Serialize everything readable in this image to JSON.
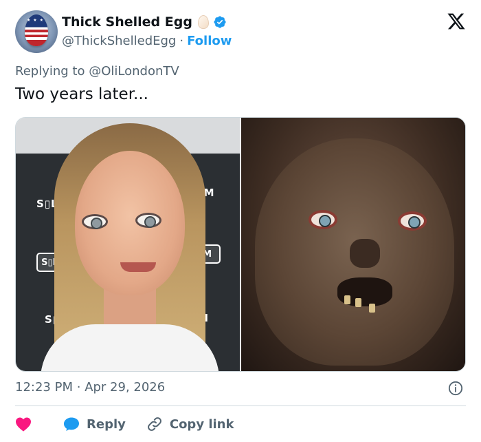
{
  "author": {
    "display_name": "Thick Shelled Egg",
    "handle": "@ThickShelledEgg",
    "separator": "·",
    "follow_label": "Follow",
    "verified": true
  },
  "reply_context": {
    "prefix": "Replying to",
    "mention": "@OliLondonTV"
  },
  "tweet": {
    "text": "Two years later..."
  },
  "media": {
    "left_image": "portrait-photo",
    "right_image": "cryptkeeper-photo"
  },
  "meta": {
    "time": "12:23 PM",
    "separator": "·",
    "date": "Apr 29, 2026"
  },
  "actions": {
    "reply_label": "Reply",
    "copy_link_label": "Copy link"
  },
  "colors": {
    "accent": "#1d9bf0",
    "heart": "#f91880",
    "text_primary": "#0f1419",
    "text_secondary": "#536471",
    "border": "#cfd9de"
  },
  "icons": [
    "verified-badge-icon",
    "x-logo-icon",
    "info-icon",
    "heart-icon",
    "reply-icon",
    "link-icon"
  ]
}
